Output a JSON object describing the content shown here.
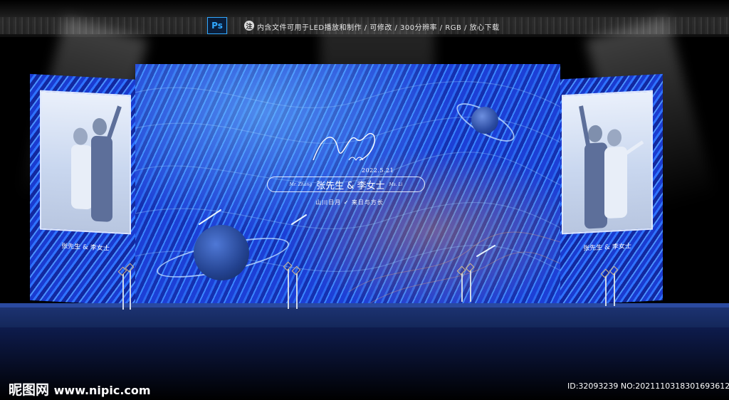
{
  "header": {
    "app_badge": "Ps",
    "note_icon_text": "注",
    "note_text": "内含文件可用于LED播放和制作 / 可修改 / 300分辨率 / RGB / 放心下载"
  },
  "backdrop": {
    "date": "2022.5.21",
    "groom_en": "Mr. Zhang",
    "bride_en": "Ms. Li",
    "names": "张先生 & 李女士",
    "tagline": "山川日月 ✓ 来日与方长"
  },
  "side_left": {
    "caption": "张先生 & 李女士"
  },
  "side_right": {
    "caption": "张先生 & 李女士"
  },
  "watermark": {
    "brand": "昵图网",
    "site": "www.nipic.com",
    "id_text": "ID:32093239 NO:20211103183016936126"
  },
  "colors": {
    "primary_blue": "#1b3ad0",
    "accent_light": "#3b86ff",
    "stage": "#1e3576"
  }
}
